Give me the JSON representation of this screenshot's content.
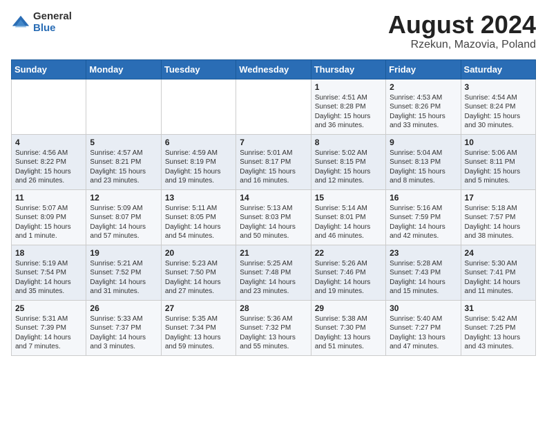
{
  "logo": {
    "general": "General",
    "blue": "Blue"
  },
  "title": "August 2024",
  "subtitle": "Rzekun, Mazovia, Poland",
  "days_of_week": [
    "Sunday",
    "Monday",
    "Tuesday",
    "Wednesday",
    "Thursday",
    "Friday",
    "Saturday"
  ],
  "weeks": [
    [
      {
        "day": "",
        "content": ""
      },
      {
        "day": "",
        "content": ""
      },
      {
        "day": "",
        "content": ""
      },
      {
        "day": "",
        "content": ""
      },
      {
        "day": "1",
        "content": "Sunrise: 4:51 AM\nSunset: 8:28 PM\nDaylight: 15 hours\nand 36 minutes."
      },
      {
        "day": "2",
        "content": "Sunrise: 4:53 AM\nSunset: 8:26 PM\nDaylight: 15 hours\nand 33 minutes."
      },
      {
        "day": "3",
        "content": "Sunrise: 4:54 AM\nSunset: 8:24 PM\nDaylight: 15 hours\nand 30 minutes."
      }
    ],
    [
      {
        "day": "4",
        "content": "Sunrise: 4:56 AM\nSunset: 8:22 PM\nDaylight: 15 hours\nand 26 minutes."
      },
      {
        "day": "5",
        "content": "Sunrise: 4:57 AM\nSunset: 8:21 PM\nDaylight: 15 hours\nand 23 minutes."
      },
      {
        "day": "6",
        "content": "Sunrise: 4:59 AM\nSunset: 8:19 PM\nDaylight: 15 hours\nand 19 minutes."
      },
      {
        "day": "7",
        "content": "Sunrise: 5:01 AM\nSunset: 8:17 PM\nDaylight: 15 hours\nand 16 minutes."
      },
      {
        "day": "8",
        "content": "Sunrise: 5:02 AM\nSunset: 8:15 PM\nDaylight: 15 hours\nand 12 minutes."
      },
      {
        "day": "9",
        "content": "Sunrise: 5:04 AM\nSunset: 8:13 PM\nDaylight: 15 hours\nand 8 minutes."
      },
      {
        "day": "10",
        "content": "Sunrise: 5:06 AM\nSunset: 8:11 PM\nDaylight: 15 hours\nand 5 minutes."
      }
    ],
    [
      {
        "day": "11",
        "content": "Sunrise: 5:07 AM\nSunset: 8:09 PM\nDaylight: 15 hours\nand 1 minute."
      },
      {
        "day": "12",
        "content": "Sunrise: 5:09 AM\nSunset: 8:07 PM\nDaylight: 14 hours\nand 57 minutes."
      },
      {
        "day": "13",
        "content": "Sunrise: 5:11 AM\nSunset: 8:05 PM\nDaylight: 14 hours\nand 54 minutes."
      },
      {
        "day": "14",
        "content": "Sunrise: 5:13 AM\nSunset: 8:03 PM\nDaylight: 14 hours\nand 50 minutes."
      },
      {
        "day": "15",
        "content": "Sunrise: 5:14 AM\nSunset: 8:01 PM\nDaylight: 14 hours\nand 46 minutes."
      },
      {
        "day": "16",
        "content": "Sunrise: 5:16 AM\nSunset: 7:59 PM\nDaylight: 14 hours\nand 42 minutes."
      },
      {
        "day": "17",
        "content": "Sunrise: 5:18 AM\nSunset: 7:57 PM\nDaylight: 14 hours\nand 38 minutes."
      }
    ],
    [
      {
        "day": "18",
        "content": "Sunrise: 5:19 AM\nSunset: 7:54 PM\nDaylight: 14 hours\nand 35 minutes."
      },
      {
        "day": "19",
        "content": "Sunrise: 5:21 AM\nSunset: 7:52 PM\nDaylight: 14 hours\nand 31 minutes."
      },
      {
        "day": "20",
        "content": "Sunrise: 5:23 AM\nSunset: 7:50 PM\nDaylight: 14 hours\nand 27 minutes."
      },
      {
        "day": "21",
        "content": "Sunrise: 5:25 AM\nSunset: 7:48 PM\nDaylight: 14 hours\nand 23 minutes."
      },
      {
        "day": "22",
        "content": "Sunrise: 5:26 AM\nSunset: 7:46 PM\nDaylight: 14 hours\nand 19 minutes."
      },
      {
        "day": "23",
        "content": "Sunrise: 5:28 AM\nSunset: 7:43 PM\nDaylight: 14 hours\nand 15 minutes."
      },
      {
        "day": "24",
        "content": "Sunrise: 5:30 AM\nSunset: 7:41 PM\nDaylight: 14 hours\nand 11 minutes."
      }
    ],
    [
      {
        "day": "25",
        "content": "Sunrise: 5:31 AM\nSunset: 7:39 PM\nDaylight: 14 hours\nand 7 minutes."
      },
      {
        "day": "26",
        "content": "Sunrise: 5:33 AM\nSunset: 7:37 PM\nDaylight: 14 hours\nand 3 minutes."
      },
      {
        "day": "27",
        "content": "Sunrise: 5:35 AM\nSunset: 7:34 PM\nDaylight: 13 hours\nand 59 minutes."
      },
      {
        "day": "28",
        "content": "Sunrise: 5:36 AM\nSunset: 7:32 PM\nDaylight: 13 hours\nand 55 minutes."
      },
      {
        "day": "29",
        "content": "Sunrise: 5:38 AM\nSunset: 7:30 PM\nDaylight: 13 hours\nand 51 minutes."
      },
      {
        "day": "30",
        "content": "Sunrise: 5:40 AM\nSunset: 7:27 PM\nDaylight: 13 hours\nand 47 minutes."
      },
      {
        "day": "31",
        "content": "Sunrise: 5:42 AM\nSunset: 7:25 PM\nDaylight: 13 hours\nand 43 minutes."
      }
    ]
  ]
}
